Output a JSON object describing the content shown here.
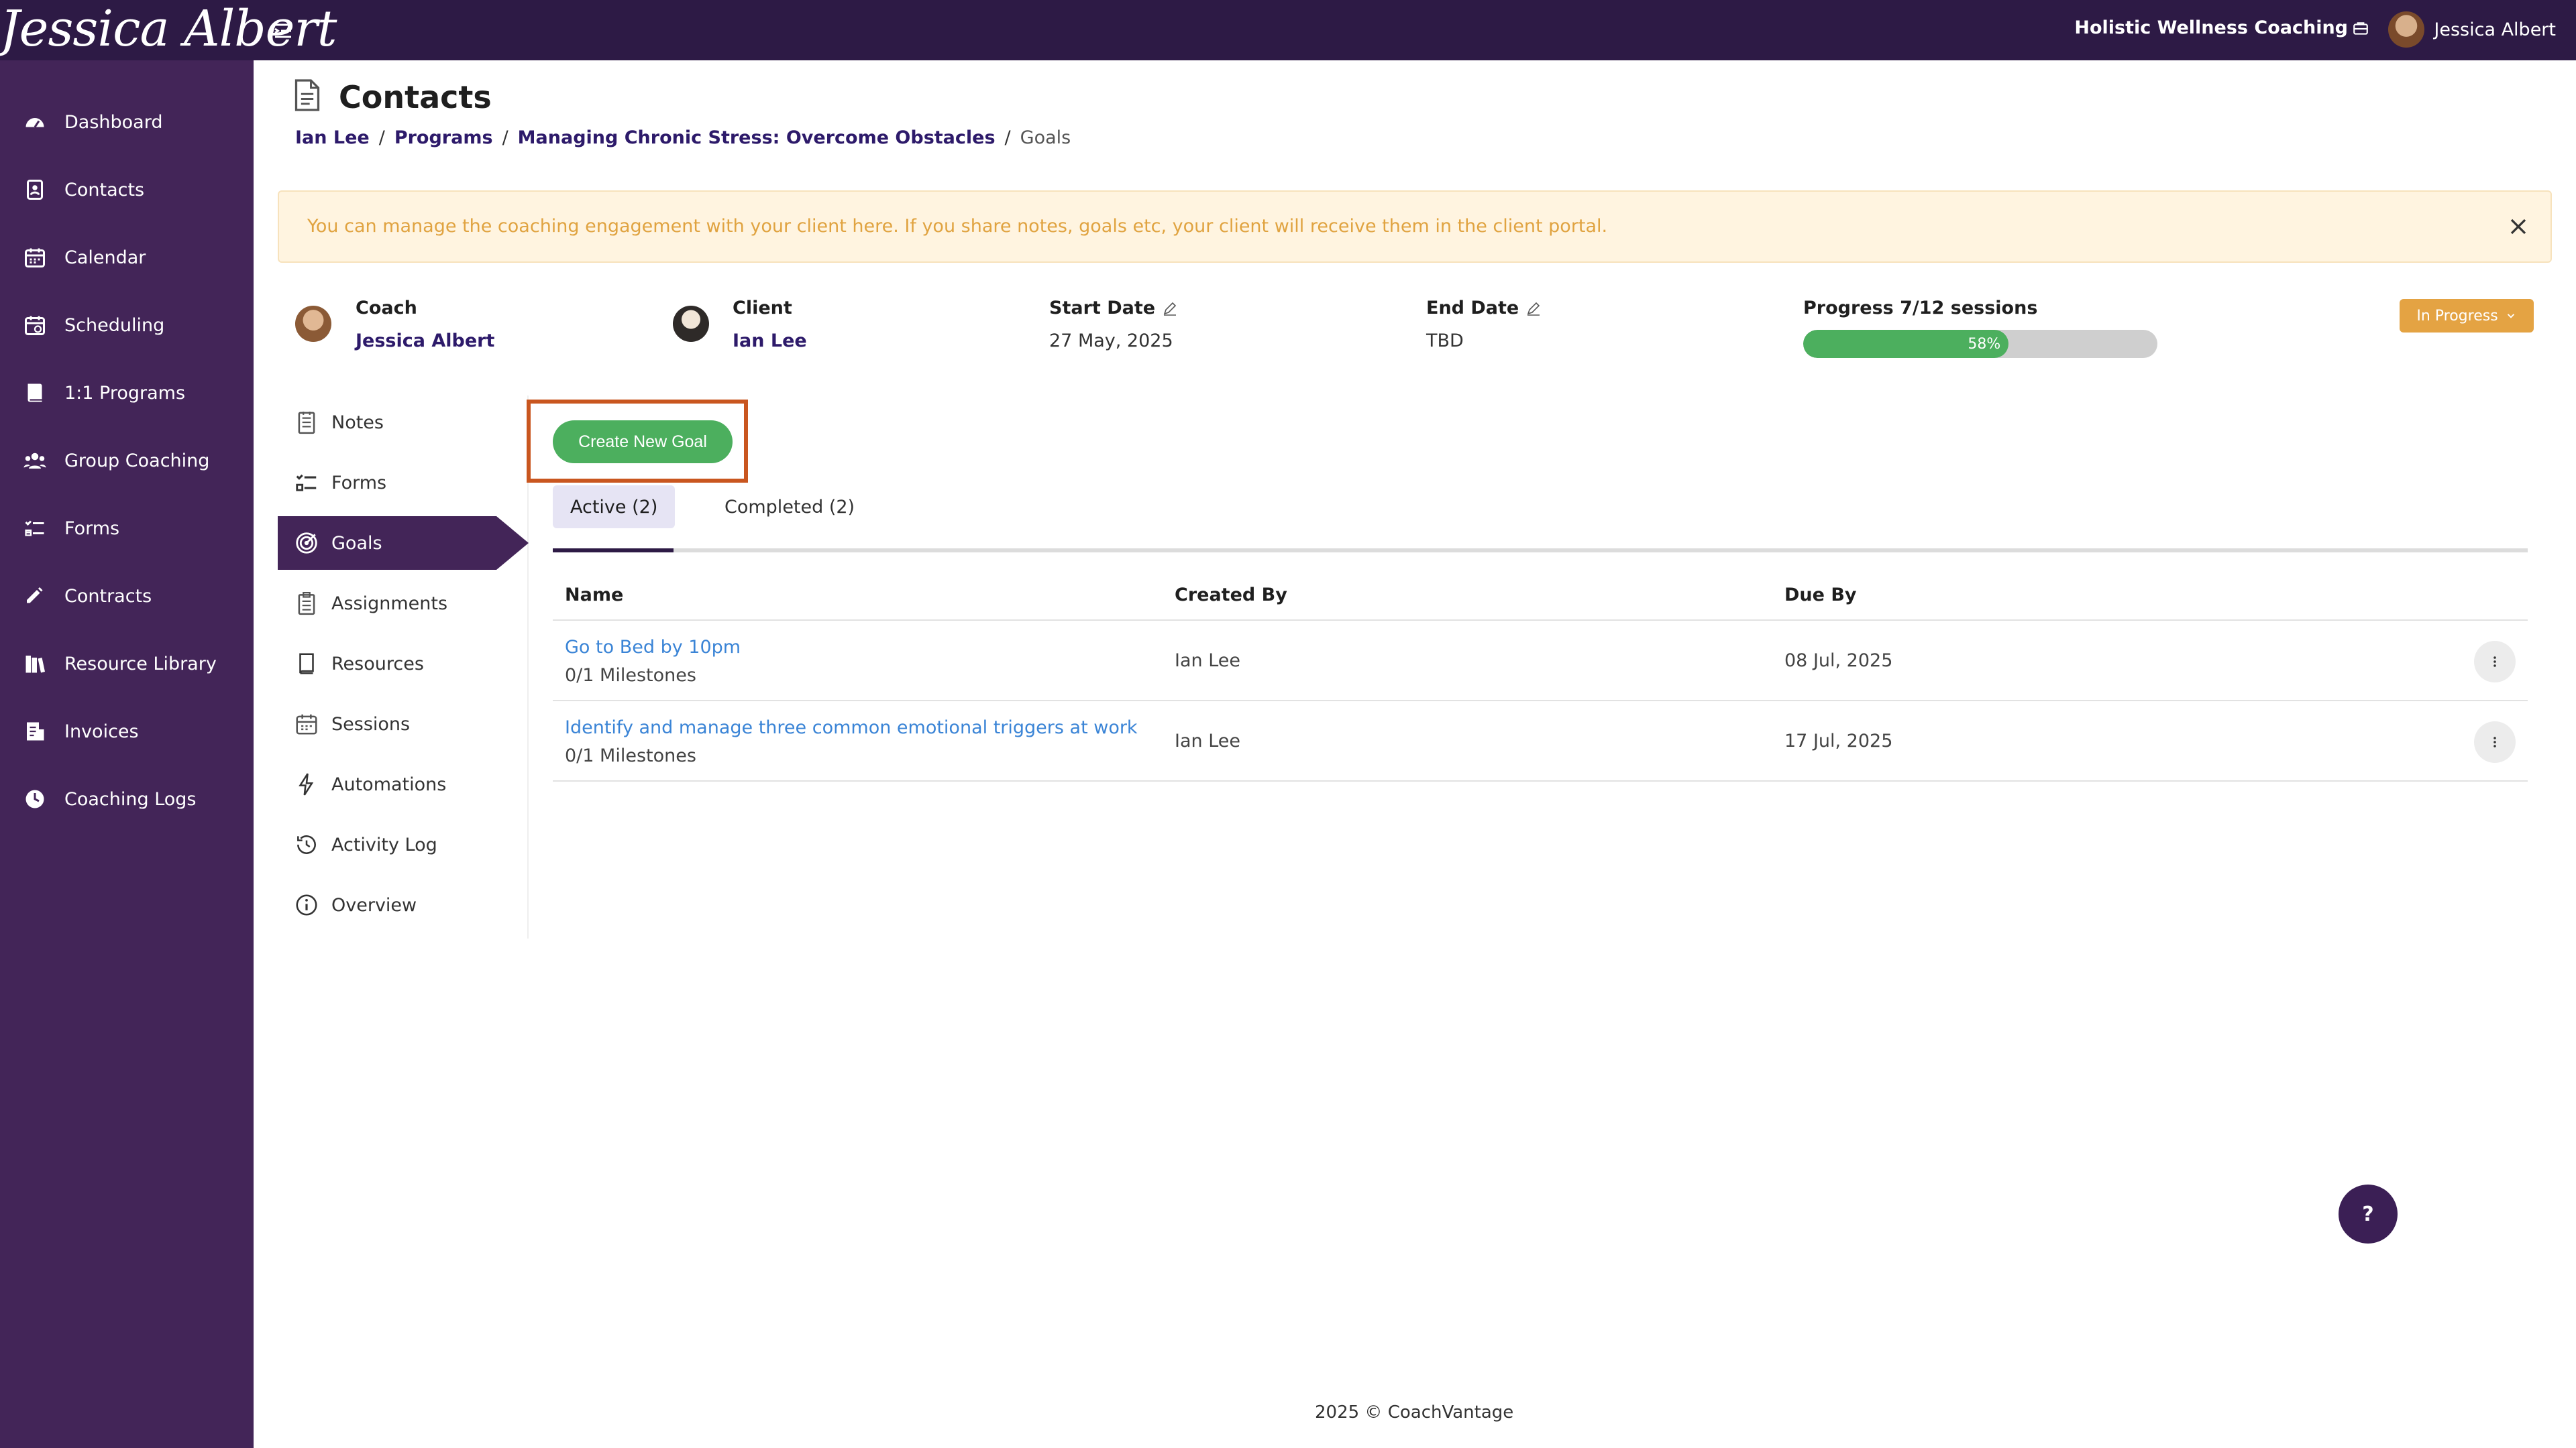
{
  "topbar": {
    "logo_text": "Jessica Albert",
    "brand": "Holistic Wellness Coaching",
    "user_name": "Jessica Albert"
  },
  "sidebar": {
    "items": [
      {
        "label": "Dashboard",
        "icon": "dashboard-icon"
      },
      {
        "label": "Contacts",
        "icon": "contacts-icon"
      },
      {
        "label": "Calendar",
        "icon": "calendar-icon"
      },
      {
        "label": "Scheduling",
        "icon": "scheduling-icon"
      },
      {
        "label": "1:1 Programs",
        "icon": "book-icon"
      },
      {
        "label": "Group Coaching",
        "icon": "group-icon"
      },
      {
        "label": "Forms",
        "icon": "forms-icon"
      },
      {
        "label": "Contracts",
        "icon": "contract-icon"
      },
      {
        "label": "Resource Library",
        "icon": "library-icon"
      },
      {
        "label": "Invoices",
        "icon": "invoice-icon"
      },
      {
        "label": "Coaching Logs",
        "icon": "clock-icon"
      }
    ]
  },
  "page": {
    "title": "Contacts",
    "breadcrumb": [
      "Ian Lee",
      "Programs",
      "Managing Chronic Stress: Overcome Obstacles",
      "Goals"
    ]
  },
  "alert": {
    "text": "You can manage the coaching engagement with your client here. If you share notes, goals etc, your client will receive them in the client portal."
  },
  "engagement": {
    "coach_label": "Coach",
    "coach_name": "Jessica Albert",
    "client_label": "Client",
    "client_name": "Ian Lee",
    "start_label": "Start Date",
    "start_value": "27 May, 2025",
    "end_label": "End Date",
    "end_value": "TBD",
    "progress_label": "Progress 7/12 sessions",
    "progress_percent": 58,
    "progress_text": "58%",
    "status": "In Progress"
  },
  "subnav": {
    "items": [
      {
        "label": "Notes",
        "icon": "notes-icon"
      },
      {
        "label": "Forms",
        "icon": "forms-icon"
      },
      {
        "label": "Goals",
        "icon": "target-icon",
        "active": true
      },
      {
        "label": "Assignments",
        "icon": "clipboard-icon"
      },
      {
        "label": "Resources",
        "icon": "book-icon"
      },
      {
        "label": "Sessions",
        "icon": "calendar-icon"
      },
      {
        "label": "Automations",
        "icon": "lightning-icon"
      },
      {
        "label": "Activity Log",
        "icon": "history-icon"
      },
      {
        "label": "Overview",
        "icon": "info-icon"
      }
    ]
  },
  "goals": {
    "create_label": "Create New Goal",
    "tabs": [
      {
        "label": "Active (2)"
      },
      {
        "label": "Completed (2)"
      }
    ],
    "columns": {
      "name": "Name",
      "created_by": "Created By",
      "due_by": "Due By"
    },
    "rows": [
      {
        "name": "Go to Bed by 10pm",
        "milestones": "0/1 Milestones",
        "created_by": "Ian Lee",
        "due": "08 Jul, 2025"
      },
      {
        "name": "Identify and manage three common emotional triggers at work",
        "milestones": "0/1 Milestones",
        "created_by": "Ian Lee",
        "due": "17 Jul, 2025"
      }
    ]
  },
  "help": {
    "label": "?"
  },
  "footer": {
    "text": "2025 © CoachVantage"
  },
  "colors": {
    "topbar": "#2d1a45",
    "sidebar": "#432558",
    "accent_green": "#4caf5e",
    "status_orange": "#e4a343",
    "highlight": "#c9561f",
    "link_blue": "#3a84d6"
  }
}
